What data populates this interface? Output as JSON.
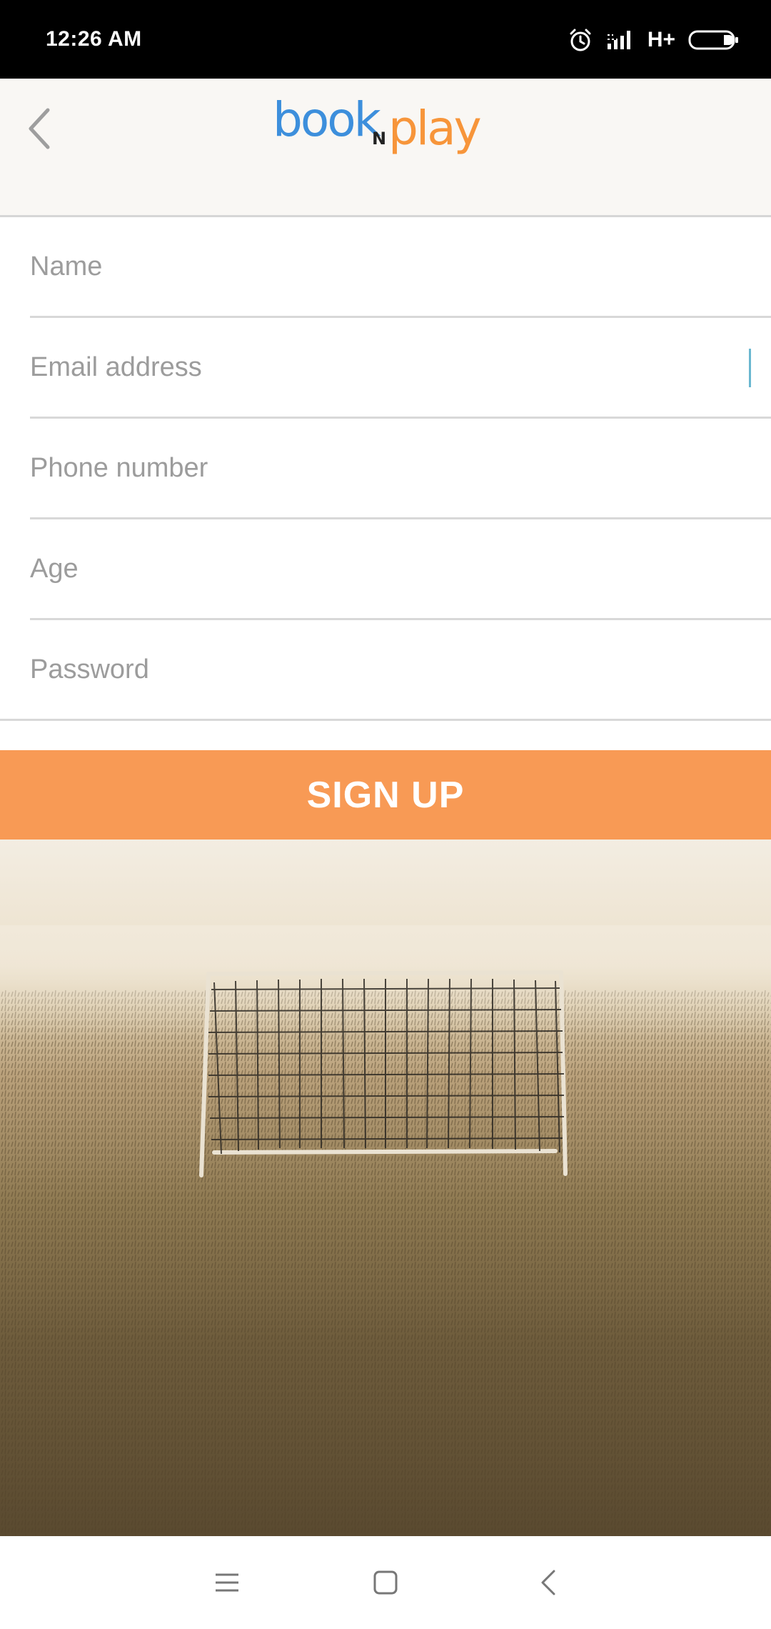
{
  "status_bar": {
    "time": "12:26 AM",
    "network": "H+",
    "icons": [
      "alarm-icon",
      "signal-icon",
      "battery-icon"
    ]
  },
  "header": {
    "back_icon": "chevron-left-icon",
    "logo": {
      "part1": "book",
      "part2": "N",
      "part3": "play",
      "color_blue": "#3d8fdc",
      "color_orange": "#f7953a"
    }
  },
  "form": {
    "name": {
      "placeholder": "Name",
      "value": ""
    },
    "email": {
      "placeholder": "Email address",
      "value": ""
    },
    "phone": {
      "placeholder": "Phone number",
      "value": ""
    },
    "age": {
      "placeholder": "Age",
      "value": ""
    },
    "password": {
      "placeholder": "Password",
      "value": ""
    }
  },
  "signup_button": {
    "label": "SIGN UP",
    "color": "#f89a55"
  },
  "nav_bar": {
    "icons": [
      "menu-icon",
      "home-square-icon",
      "back-chevron-icon"
    ]
  }
}
